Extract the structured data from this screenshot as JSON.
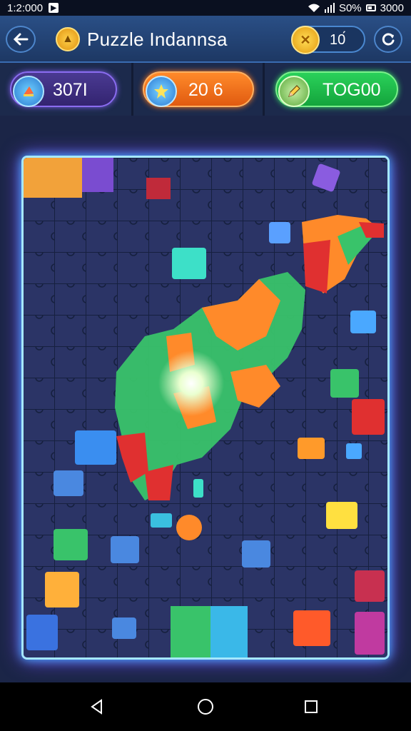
{
  "status_bar": {
    "time": "1:2:000",
    "battery_text": "S0%",
    "extra_text": "3000"
  },
  "app_bar": {
    "title": "Puzzle Indannsa",
    "coins": "10́"
  },
  "stats": {
    "purple_value": "307I",
    "orange_value": "20 6",
    "green_value": "TOG00"
  },
  "colors": {
    "accent_purple": "#8a6cf0",
    "accent_orange": "#ff7a20",
    "accent_green": "#3ae06a",
    "board_glow": "#3fb6ff"
  },
  "icons": [
    "back-arrow-icon",
    "up-arrow-coin-icon",
    "coin-x-icon",
    "refresh-icon",
    "paint-bucket-icon",
    "star-hint-icon",
    "pencil-icon",
    "nav-back-icon",
    "nav-home-icon",
    "nav-recents-icon"
  ]
}
